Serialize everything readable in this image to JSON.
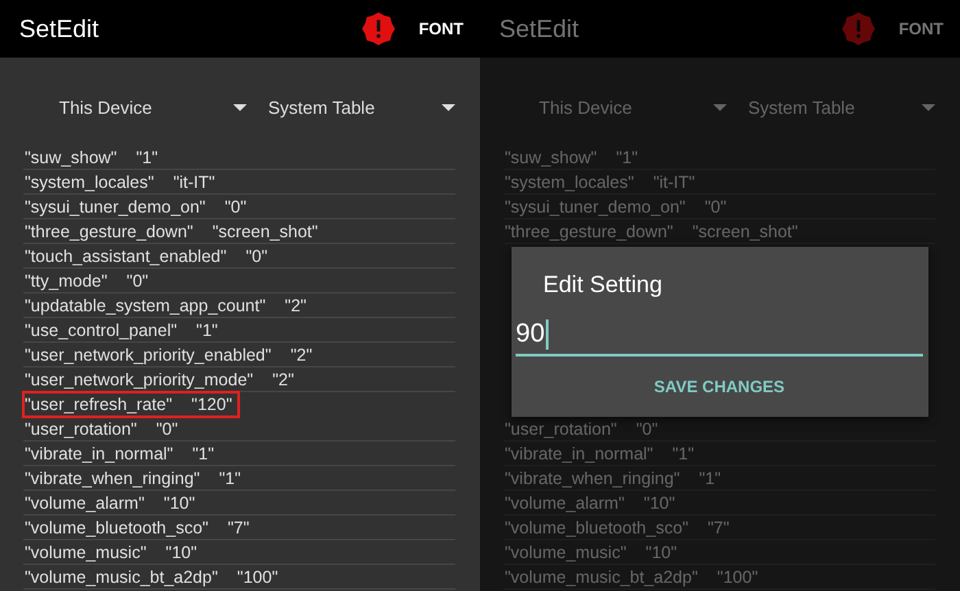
{
  "screens": [
    {
      "app_title": "SetEdit",
      "font_button": "FONT",
      "dimmed": false,
      "spinners": [
        {
          "label": "This Device"
        },
        {
          "label": "System Table"
        }
      ],
      "rows": [
        {
          "kind": "setting",
          "name": "\"suw_show\"",
          "value": "\"1\"",
          "highlighted": false
        },
        {
          "kind": "setting",
          "name": "\"system_locales\"",
          "value": "\"it-IT\"",
          "highlighted": false
        },
        {
          "kind": "setting",
          "name": "\"sysui_tuner_demo_on\"",
          "value": "\"0\"",
          "highlighted": false
        },
        {
          "kind": "setting",
          "name": "\"three_gesture_down\"",
          "value": "\"screen_shot\"",
          "highlighted": false
        },
        {
          "kind": "setting",
          "name": "\"touch_assistant_enabled\"",
          "value": "\"0\"",
          "highlighted": false
        },
        {
          "kind": "setting",
          "name": "\"tty_mode\"",
          "value": "\"0\"",
          "highlighted": false
        },
        {
          "kind": "setting",
          "name": "\"updatable_system_app_count\"",
          "value": "\"2\"",
          "highlighted": false
        },
        {
          "kind": "setting",
          "name": "\"use_control_panel\"",
          "value": "\"1\"",
          "highlighted": false
        },
        {
          "kind": "setting",
          "name": "\"user_network_priority_enabled\"",
          "value": "\"2\"",
          "highlighted": false
        },
        {
          "kind": "setting",
          "name": "\"user_network_priority_mode\"",
          "value": "\"2\"",
          "highlighted": false
        },
        {
          "kind": "setting",
          "name": "\"user_refresh_rate\"",
          "value": "\"120\"",
          "highlighted": true
        },
        {
          "kind": "setting",
          "name": "\"user_rotation\"",
          "value": "\"0\"",
          "highlighted": false
        },
        {
          "kind": "setting",
          "name": "\"vibrate_in_normal\"",
          "value": "\"1\"",
          "highlighted": false
        },
        {
          "kind": "setting",
          "name": "\"vibrate_when_ringing\"",
          "value": "\"1\"",
          "highlighted": false
        },
        {
          "kind": "setting",
          "name": "\"volume_alarm\"",
          "value": "\"10\"",
          "highlighted": false
        },
        {
          "kind": "setting",
          "name": "\"volume_bluetooth_sco\"",
          "value": "\"7\"",
          "highlighted": false
        },
        {
          "kind": "setting",
          "name": "\"volume_music\"",
          "value": "\"10\"",
          "highlighted": false
        },
        {
          "kind": "setting",
          "name": "\"volume_music_bt_a2dp\"",
          "value": "\"100\"",
          "highlighted": false
        }
      ]
    },
    {
      "app_title": "SetEdit",
      "font_button": "FONT",
      "dimmed": true,
      "spinners": [
        {
          "label": "This Device"
        },
        {
          "label": "System Table"
        }
      ],
      "rows": [
        {
          "kind": "setting",
          "name": "\"suw_show\"",
          "value": "\"1\"",
          "highlighted": false
        },
        {
          "kind": "setting",
          "name": "\"system_locales\"",
          "value": "\"it-IT\"",
          "highlighted": false
        },
        {
          "kind": "setting",
          "name": "\"sysui_tuner_demo_on\"",
          "value": "\"0\"",
          "highlighted": false
        },
        {
          "kind": "setting",
          "name": "\"three_gesture_down\"",
          "value": "\"screen_shot\"",
          "highlighted": false
        },
        {
          "kind": "covered"
        },
        {
          "kind": "covered"
        },
        {
          "kind": "covered"
        },
        {
          "kind": "covered"
        },
        {
          "kind": "covered"
        },
        {
          "kind": "covered"
        },
        {
          "kind": "covered"
        },
        {
          "kind": "setting",
          "name": "\"user_rotation\"",
          "value": "\"0\"",
          "highlighted": false
        },
        {
          "kind": "setting",
          "name": "\"vibrate_in_normal\"",
          "value": "\"1\"",
          "highlighted": false
        },
        {
          "kind": "setting",
          "name": "\"vibrate_when_ringing\"",
          "value": "\"1\"",
          "highlighted": false
        },
        {
          "kind": "setting",
          "name": "\"volume_alarm\"",
          "value": "\"10\"",
          "highlighted": false
        },
        {
          "kind": "setting",
          "name": "\"volume_bluetooth_sco\"",
          "value": "\"7\"",
          "highlighted": false
        },
        {
          "kind": "setting",
          "name": "\"volume_music\"",
          "value": "\"10\"",
          "highlighted": false
        },
        {
          "kind": "setting",
          "name": "\"volume_music_bt_a2dp\"",
          "value": "\"100\"",
          "highlighted": false
        }
      ],
      "dialog": {
        "title": "Edit Setting",
        "value": "90",
        "button": "SAVE CHANGES"
      }
    }
  ]
}
